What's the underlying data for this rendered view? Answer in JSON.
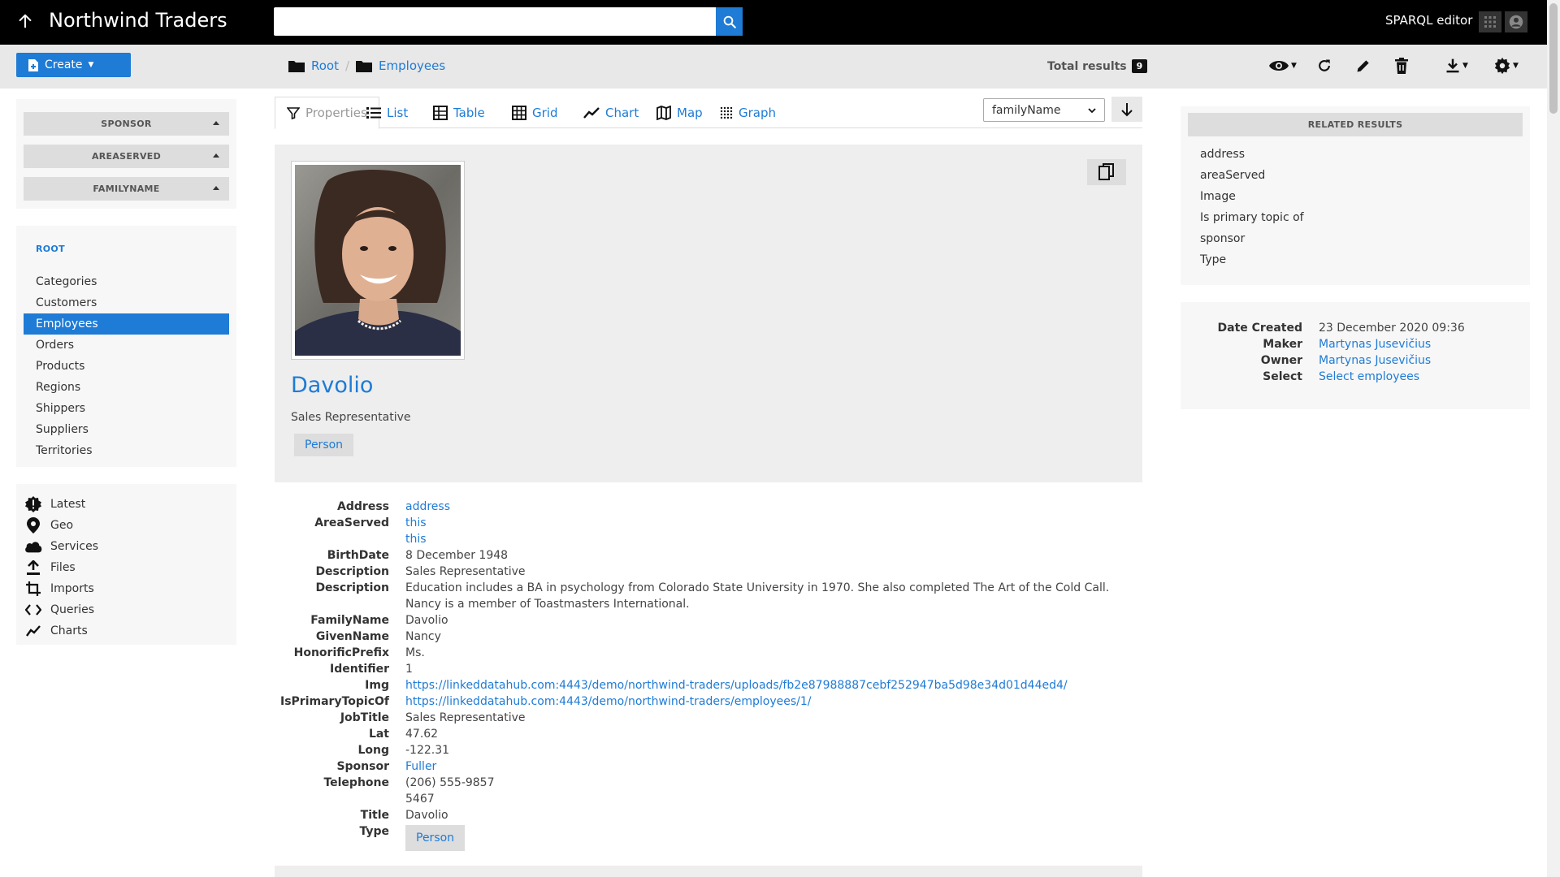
{
  "topbar": {
    "brand": "Northwind Traders",
    "search_placeholder": "",
    "sparql_label": "SPARQL editor"
  },
  "actionbar": {
    "create_label": "Create",
    "breadcrumb": [
      "Root",
      "Employees"
    ],
    "total_label": "Total results",
    "total_count": "9"
  },
  "facets": [
    "SPONSOR",
    "AREASERVED",
    "FAMILYNAME"
  ],
  "nav": {
    "root_label": "ROOT",
    "items": [
      "Categories",
      "Customers",
      "Employees",
      "Orders",
      "Products",
      "Regions",
      "Shippers",
      "Suppliers",
      "Territories"
    ],
    "active": "Employees"
  },
  "tools": [
    {
      "label": "Latest",
      "icon": "alert-icon"
    },
    {
      "label": "Geo",
      "icon": "map-pin-icon"
    },
    {
      "label": "Services",
      "icon": "cloud-icon"
    },
    {
      "label": "Files",
      "icon": "upload-icon"
    },
    {
      "label": "Imports",
      "icon": "crop-icon"
    },
    {
      "label": "Queries",
      "icon": "code-icon"
    },
    {
      "label": "Charts",
      "icon": "chart-line-icon"
    }
  ],
  "tabs": [
    "Properties",
    "List",
    "Table",
    "Grid",
    "Chart",
    "Map",
    "Graph"
  ],
  "active_tab": "Properties",
  "sort": {
    "selected": "familyName"
  },
  "resource": {
    "name": "Davolio",
    "subtitle": "Sales Representative",
    "type_pill": "Person"
  },
  "properties": [
    {
      "key": "Address",
      "values": [
        {
          "text": "address",
          "link": true
        }
      ]
    },
    {
      "key": "AreaServed",
      "values": [
        {
          "text": "this",
          "link": true
        },
        {
          "text": "this",
          "link": true
        }
      ]
    },
    {
      "key": "BirthDate",
      "values": [
        {
          "text": "8 December 1948",
          "link": false
        }
      ]
    },
    {
      "key": "Description",
      "values": [
        {
          "text": "Sales Representative",
          "link": false
        }
      ]
    },
    {
      "key": "Description",
      "values": [
        {
          "text": "Education includes a BA in psychology from Colorado State University in 1970. She also completed The Art of the Cold Call. Nancy is a member of Toastmasters International.",
          "link": false
        }
      ]
    },
    {
      "key": "FamilyName",
      "values": [
        {
          "text": "Davolio",
          "link": false
        }
      ]
    },
    {
      "key": "GivenName",
      "values": [
        {
          "text": "Nancy",
          "link": false
        }
      ]
    },
    {
      "key": "HonorificPrefix",
      "values": [
        {
          "text": "Ms.",
          "link": false
        }
      ]
    },
    {
      "key": "Identifier",
      "values": [
        {
          "text": "1",
          "link": false
        }
      ]
    },
    {
      "key": "Img",
      "values": [
        {
          "text": "https://linkeddatahub.com:4443/demo/northwind-traders/uploads/fb2e87988887cebf252947ba5d98e34d01d44ed4/",
          "link": true
        }
      ]
    },
    {
      "key": "IsPrimaryTopicOf",
      "values": [
        {
          "text": "https://linkeddatahub.com:4443/demo/northwind-traders/employees/1/",
          "link": true
        }
      ]
    },
    {
      "key": "JobTitle",
      "values": [
        {
          "text": "Sales Representative",
          "link": false
        }
      ]
    },
    {
      "key": "Lat",
      "values": [
        {
          "text": "47.62",
          "link": false
        }
      ]
    },
    {
      "key": "Long",
      "values": [
        {
          "text": "-122.31",
          "link": false
        }
      ]
    },
    {
      "key": "Sponsor",
      "values": [
        {
          "text": "Fuller",
          "link": true
        }
      ]
    },
    {
      "key": "Telephone",
      "values": [
        {
          "text": "(206) 555-9857",
          "link": false
        },
        {
          "text": "5467",
          "link": false
        }
      ]
    },
    {
      "key": "Title",
      "values": [
        {
          "text": "Davolio",
          "link": false
        }
      ]
    },
    {
      "key": "Type",
      "values": [
        {
          "text": "Person",
          "link": true,
          "pill": true
        }
      ]
    }
  ],
  "related": {
    "header": "RELATED RESULTS",
    "items": [
      "address",
      "areaServed",
      "Image",
      "Is primary topic of",
      "sponsor",
      "Type"
    ]
  },
  "meta": [
    {
      "key": "Date Created",
      "value": "23 December 2020 09:36",
      "link": false
    },
    {
      "key": "Maker",
      "value": "Martynas Jusevičius",
      "link": true
    },
    {
      "key": "Owner",
      "value": "Martynas Jusevičius",
      "link": true
    },
    {
      "key": "Select",
      "value": "Select employees",
      "link": true
    }
  ],
  "colors": {
    "accent": "#1e7bd6",
    "topbar": "#000000",
    "panel": "#f7f7f7"
  }
}
